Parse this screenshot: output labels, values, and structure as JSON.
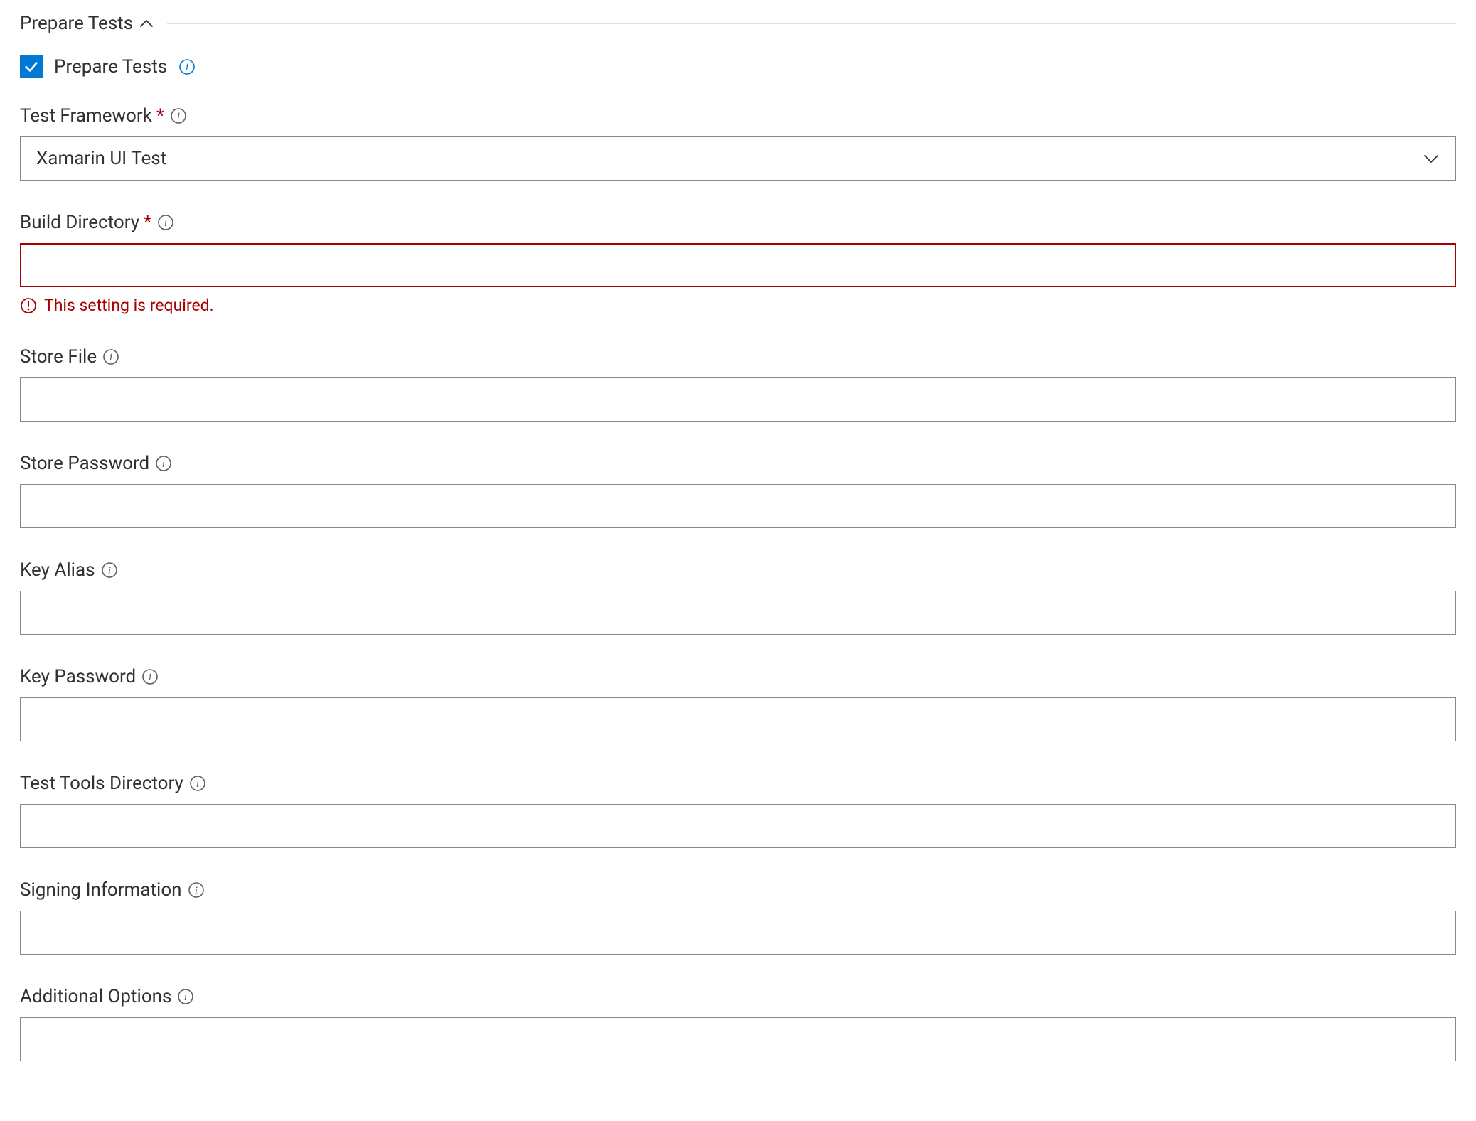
{
  "section": {
    "title": "Prepare Tests"
  },
  "checkbox": {
    "label": "Prepare Tests",
    "checked": true
  },
  "fields": {
    "testFramework": {
      "label": "Test Framework",
      "required": true,
      "value": "Xamarin UI Test"
    },
    "buildDirectory": {
      "label": "Build Directory",
      "required": true,
      "value": "",
      "error": "This setting is required."
    },
    "storeFile": {
      "label": "Store File",
      "value": ""
    },
    "storePassword": {
      "label": "Store Password",
      "value": ""
    },
    "keyAlias": {
      "label": "Key Alias",
      "value": ""
    },
    "keyPassword": {
      "label": "Key Password",
      "value": ""
    },
    "testToolsDirectory": {
      "label": "Test Tools Directory",
      "value": ""
    },
    "signingInformation": {
      "label": "Signing Information",
      "value": ""
    },
    "additionalOptions": {
      "label": "Additional Options",
      "value": ""
    }
  }
}
